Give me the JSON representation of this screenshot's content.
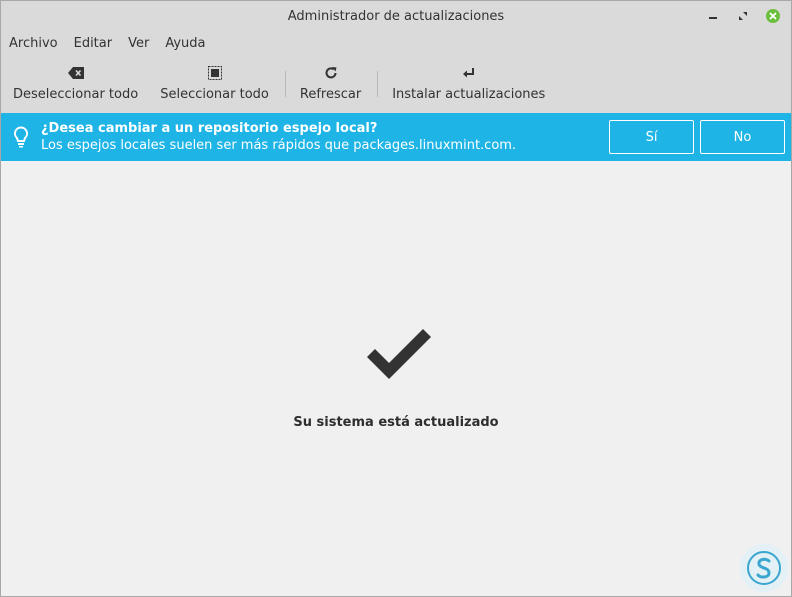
{
  "window": {
    "title": "Administrador de actualizaciones"
  },
  "menu": {
    "items": [
      "Archivo",
      "Editar",
      "Ver",
      "Ayuda"
    ]
  },
  "toolbar": {
    "deselect_label": "Deseleccionar todo",
    "select_label": "Seleccionar todo",
    "refresh_label": "Refrescar",
    "install_label": "Instalar actualizaciones"
  },
  "infobar": {
    "title": "¿Desea cambiar a un repositorio espejo local?",
    "subtitle": "Los espejos locales suelen ser más rápidos que packages.linuxmint.com.",
    "yes_label": "Sí",
    "no_label": "No"
  },
  "main": {
    "status": "Su sistema está actualizado"
  },
  "colors": {
    "infobar_bg": "#1eb4e6",
    "close_button": "#6abf3c",
    "checkmark": "#333333",
    "watermark_accent": "#3aa6d0"
  },
  "icons": {
    "minimize": "minimize-icon",
    "maximize": "maximize-icon",
    "close": "close-icon",
    "deselect": "backspace-icon",
    "select": "select-all-icon",
    "refresh": "refresh-icon",
    "install": "enter-icon",
    "info": "lightbulb-icon",
    "status": "checkmark-icon",
    "watermark": "logo-icon"
  }
}
